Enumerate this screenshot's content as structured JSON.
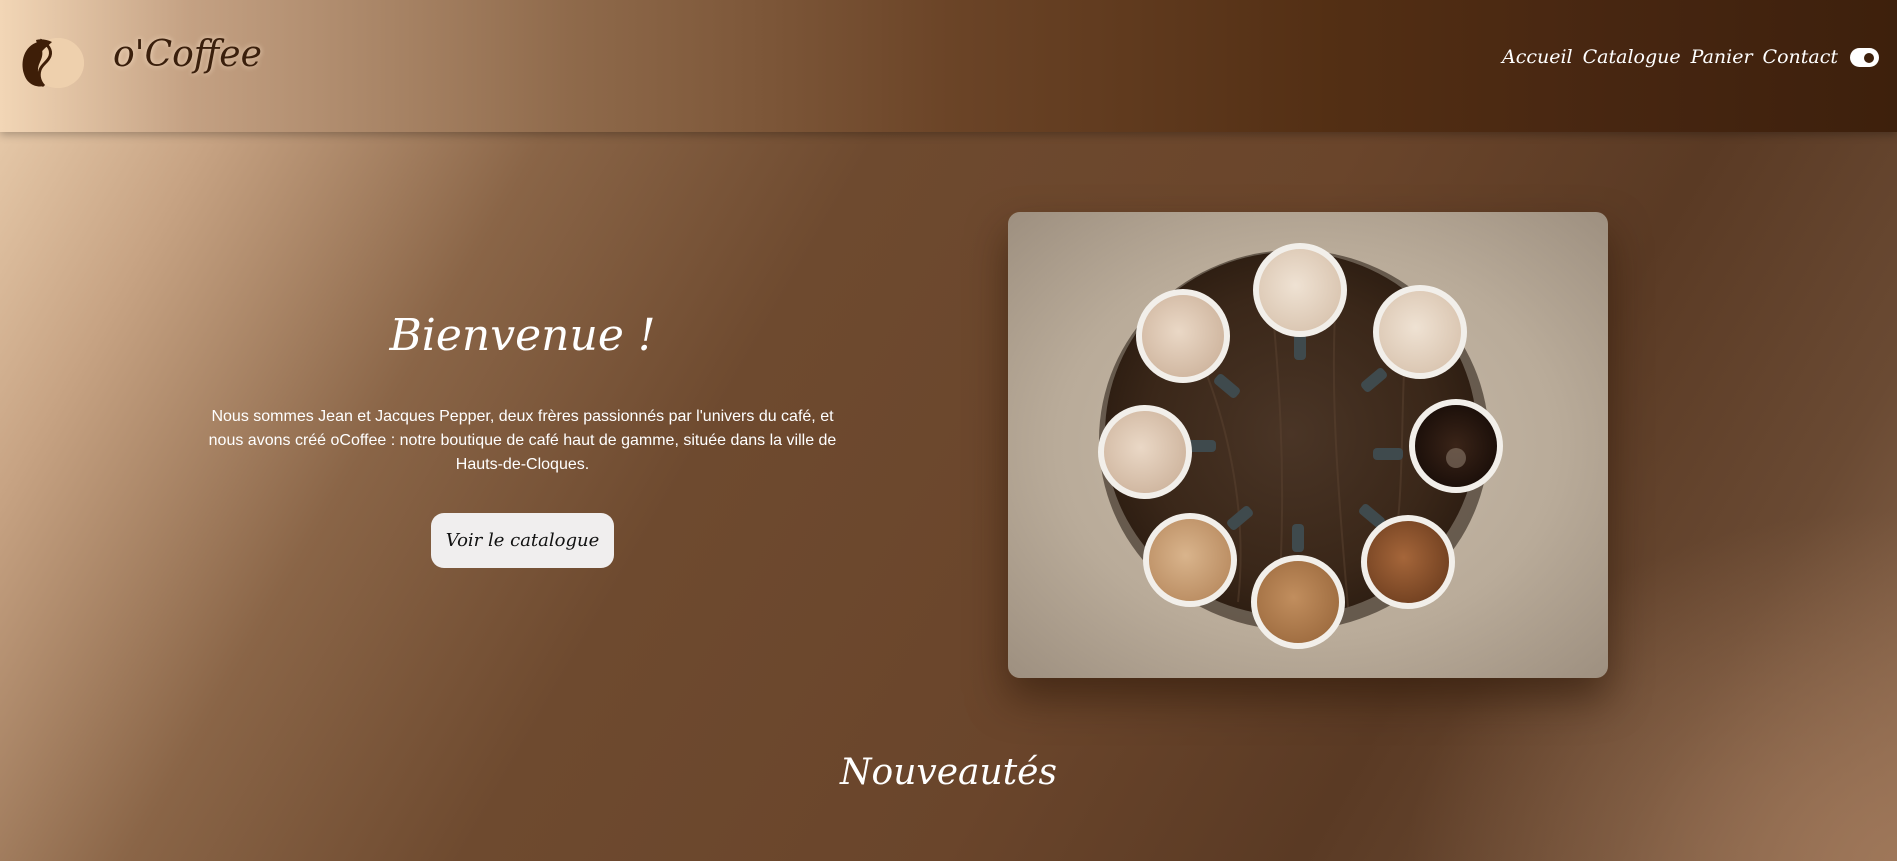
{
  "header": {
    "brand": "o'Coffee",
    "nav": [
      {
        "label": "Accueil"
      },
      {
        "label": "Catalogue"
      },
      {
        "label": "Panier"
      },
      {
        "label": "Contact"
      }
    ]
  },
  "hero": {
    "title": "Bienvenue !",
    "text": "Nous sommes Jean et Jacques Pepper, deux frères passionnés par l'univers du café, et nous avons créé oCoffee : notre boutique de café haut de gamme, située dans la ville de Hauts-de-Cloques.",
    "cta_label": "Voir le catalogue"
  },
  "news": {
    "title": "Nouveautés"
  },
  "colors": {
    "header_dark": "#3d200c",
    "header_light": "#f2d6b6",
    "background": "#6a452b",
    "button_bg": "#f0eeee"
  },
  "icons": {
    "logo": "coffee-bean-icon",
    "theme_toggle": "toggle-switch-icon"
  }
}
